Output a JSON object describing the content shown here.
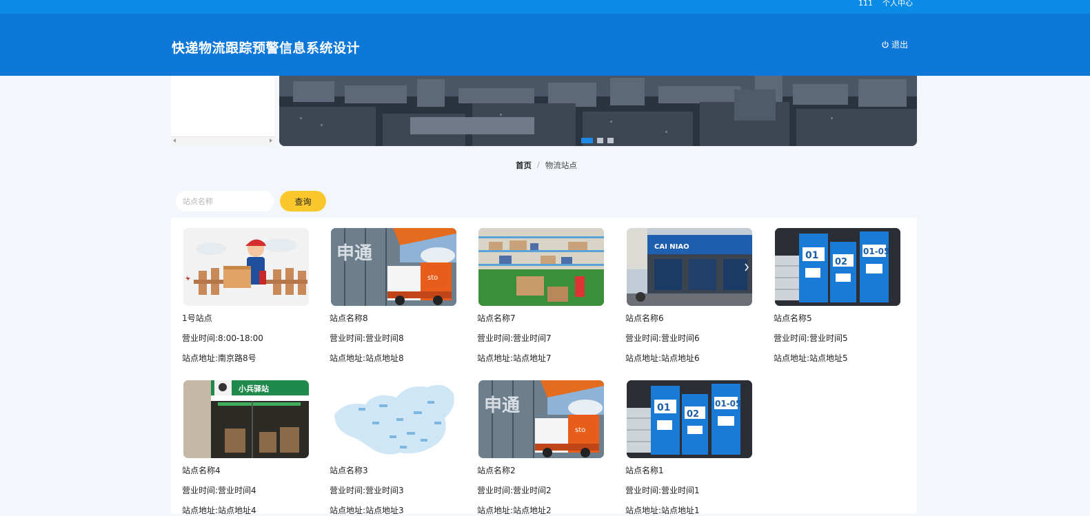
{
  "topbar": {
    "user": "111",
    "personal_center": "个人中心"
  },
  "header": {
    "title": "快递物流跟踪预警信息系统设计",
    "logout": "退出"
  },
  "breadcrumb": {
    "home": "首页",
    "separator": "/",
    "current": "物流站点"
  },
  "search": {
    "placeholder": "站点名称",
    "button": "查询"
  },
  "banner": {
    "slide_count": 3,
    "active_slide": 1
  },
  "colors": {
    "top_strip": "#0a8be6",
    "header": "#0e78d8",
    "query_button": "#fbc82c",
    "page_bg": "#f3f6fb"
  },
  "stations": [
    {
      "name": "1号站点",
      "hours": "营业时间:8:00-18:00",
      "address": "站点地址:南京路8号",
      "image": "courier-with-box"
    },
    {
      "name": "站点名称8",
      "hours": "营业时间:营业时间8",
      "address": "站点地址:站点地址8",
      "image": "sto-express-truck"
    },
    {
      "name": "站点名称7",
      "hours": "营业时间:营业时间7",
      "address": "站点地址:站点地址7",
      "image": "parcel-shelves"
    },
    {
      "name": "站点名称6",
      "hours": "营业时间:营业时间6",
      "address": "站点地址:站点地址6",
      "image": "cainiao-station-storefront"
    },
    {
      "name": "站点名称5",
      "hours": "营业时间:营业时间5",
      "address": "站点地址:站点地址5",
      "image": "parcel-locker"
    },
    {
      "name": "站点名称4",
      "hours": "营业时间:营业时间4",
      "address": "站点地址:站点地址4",
      "image": "green-storefront"
    },
    {
      "name": "站点名称3",
      "hours": "营业时间:营业时间3",
      "address": "站点地址:站点地址3",
      "image": "china-map"
    },
    {
      "name": "站点名称2",
      "hours": "营业时间:营业时间2",
      "address": "站点地址:站点地址2",
      "image": "sto-express-truck"
    },
    {
      "name": "站点名称1",
      "hours": "营业时间:营业时间1",
      "address": "站点地址:站点地址1",
      "image": "parcel-locker"
    }
  ]
}
